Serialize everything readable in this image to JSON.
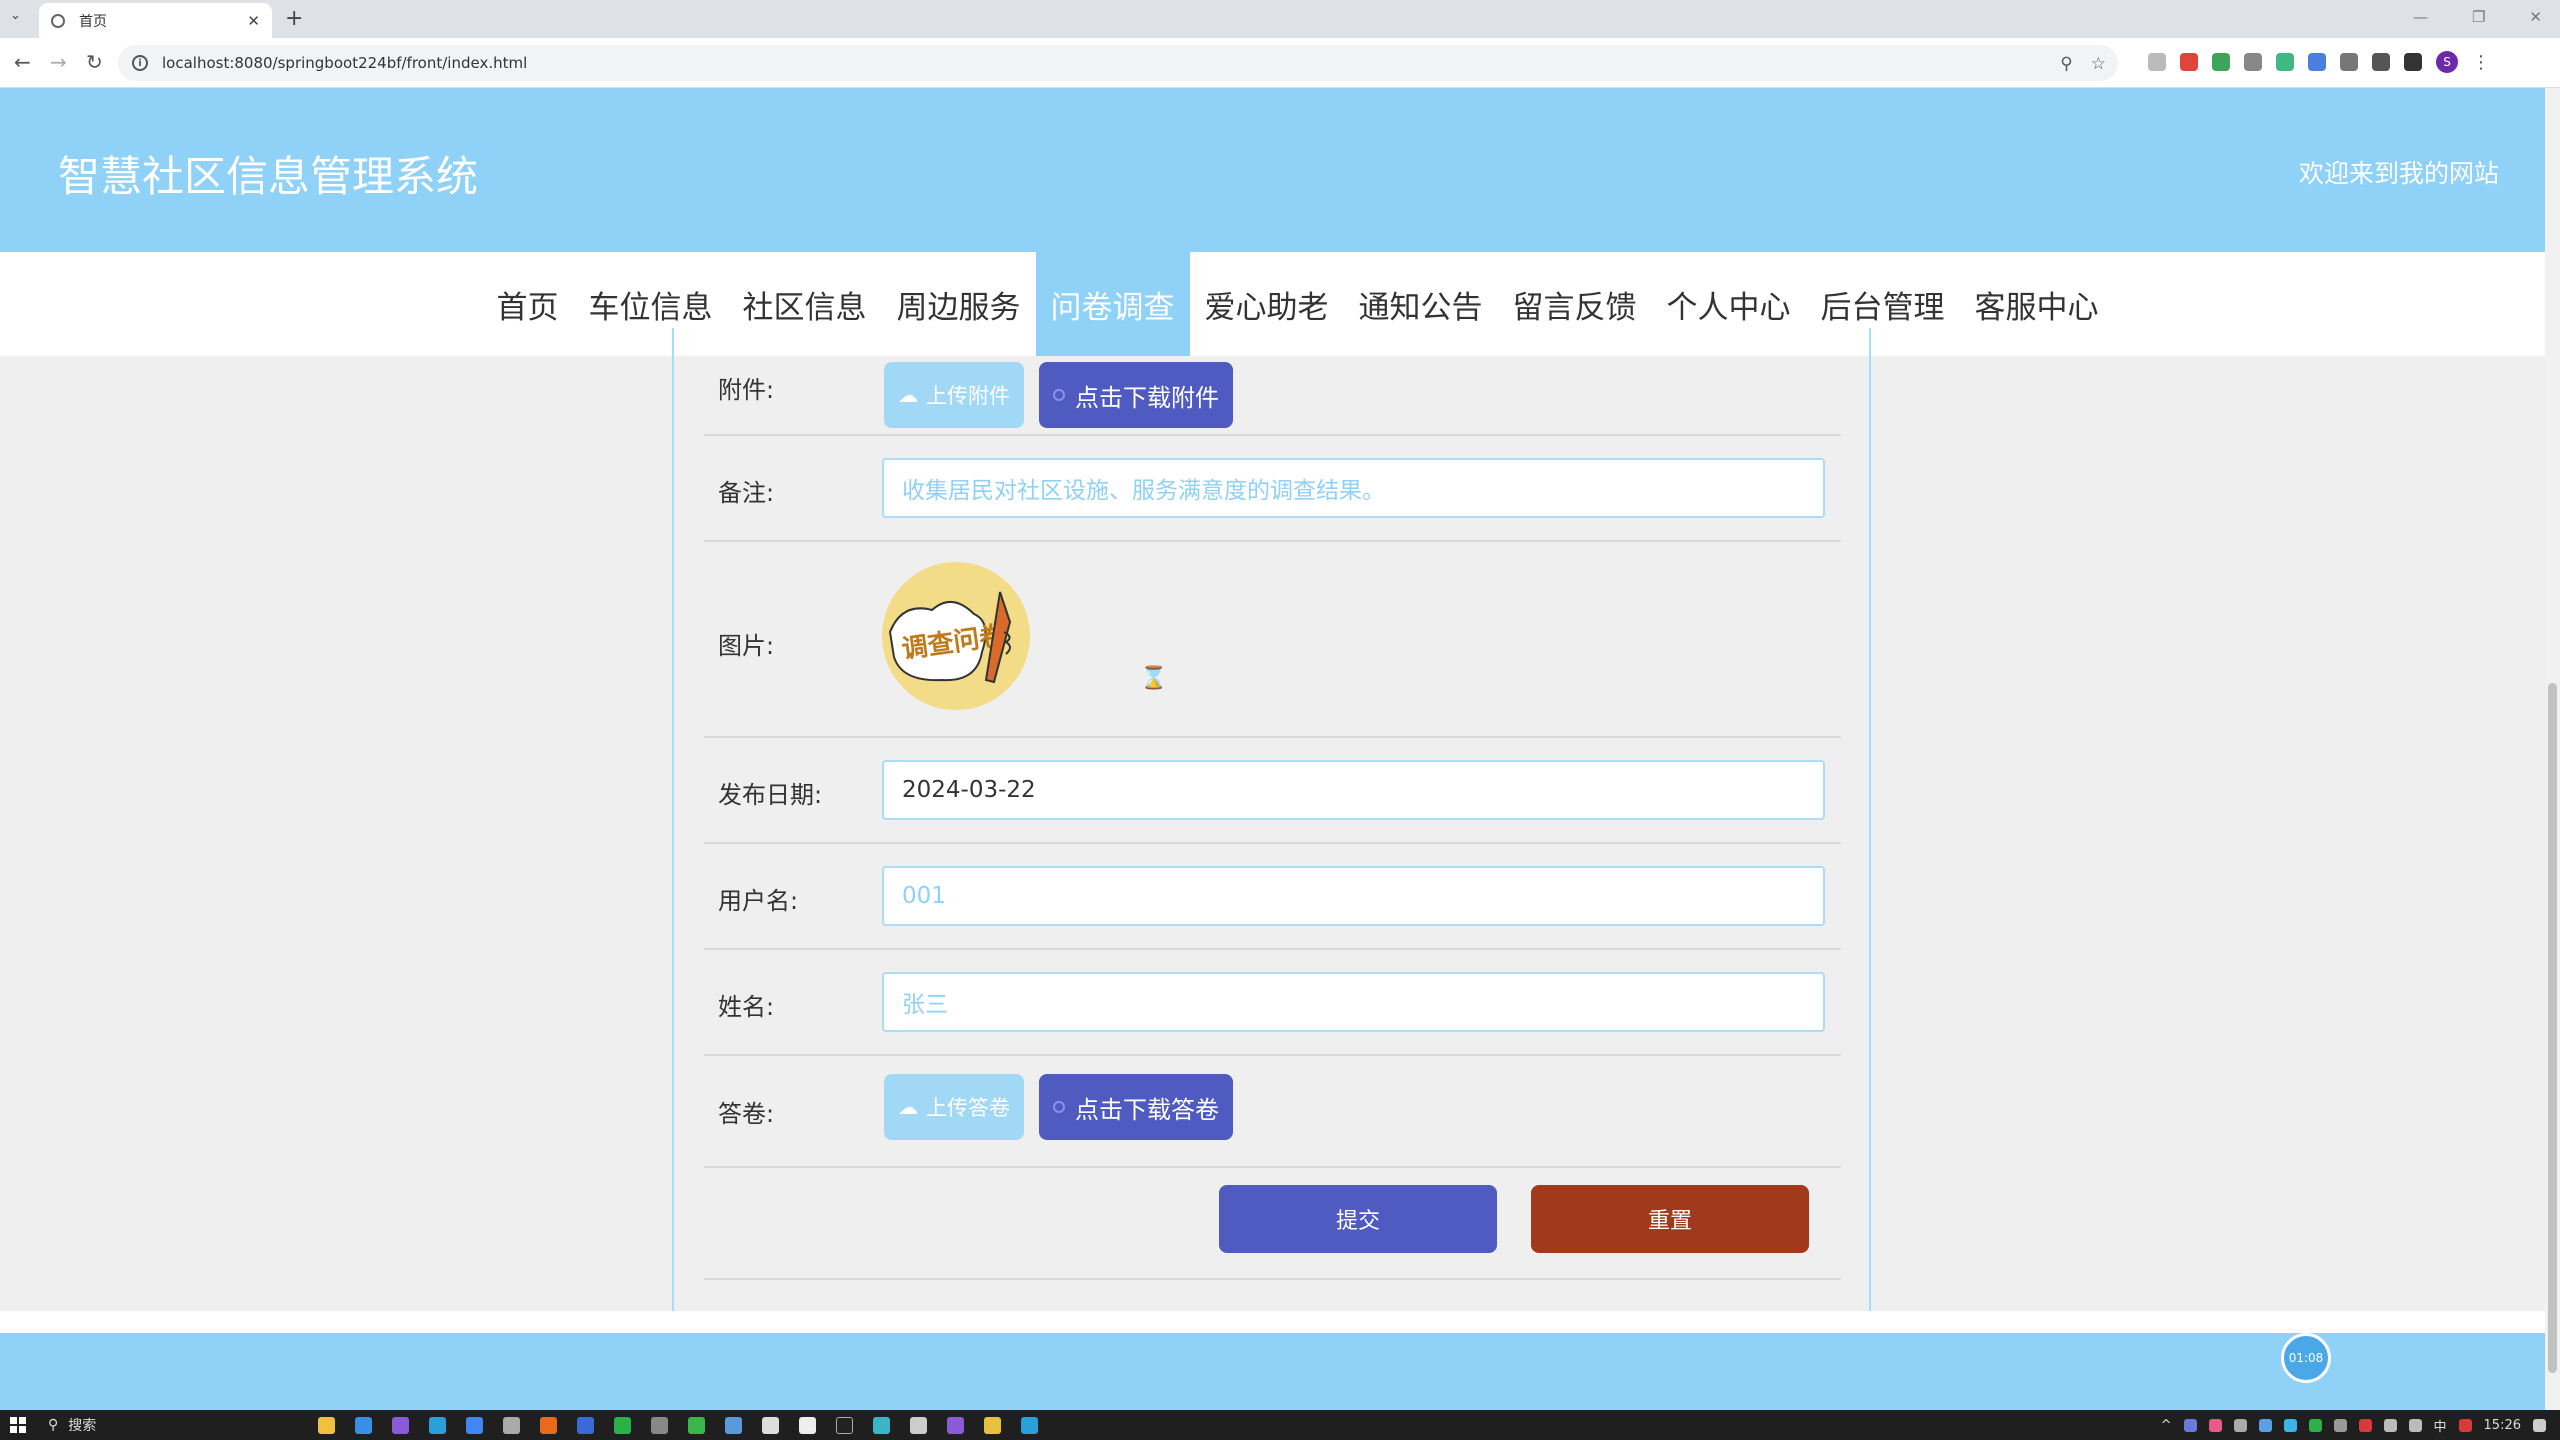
{
  "browser": {
    "tab_title": "首页",
    "url": "localhost:8080/springboot224bf/front/index.html",
    "profile_initial": "S"
  },
  "header": {
    "site_title": "智慧社区信息管理系统",
    "welcome": "欢迎来到我的网站"
  },
  "nav": {
    "items": [
      "首页",
      "车位信息",
      "社区信息",
      "周边服务",
      "问卷调查",
      "爱心助老",
      "通知公告",
      "留言反馈",
      "个人中心",
      "后台管理",
      "客服中心"
    ],
    "active": "问卷调查"
  },
  "form": {
    "attachment": {
      "label": "附件:",
      "upload": "上传附件",
      "download": "点击下载附件"
    },
    "remark": {
      "label": "备注:",
      "placeholder": "收集居民对社区设施、服务满意度的调查结果。"
    },
    "picture": {
      "label": "图片:",
      "image_text": "调查问卷"
    },
    "publish_date": {
      "label": "发布日期:",
      "value": "2024-03-22"
    },
    "username": {
      "label": "用户名:",
      "placeholder": "001"
    },
    "name": {
      "label": "姓名:",
      "placeholder": "张三"
    },
    "answer": {
      "label": "答卷:",
      "upload": "上传答卷",
      "download": "点击下载答卷"
    },
    "submit": "提交",
    "reset": "重置"
  },
  "timer": "01:08",
  "taskbar": {
    "search": "搜索",
    "lang": "中",
    "time": "15:26"
  },
  "colors": {
    "header_bg": "#8fd1f7",
    "primary_button": "#4f5bc0",
    "reset_button": "#a03a1a"
  }
}
